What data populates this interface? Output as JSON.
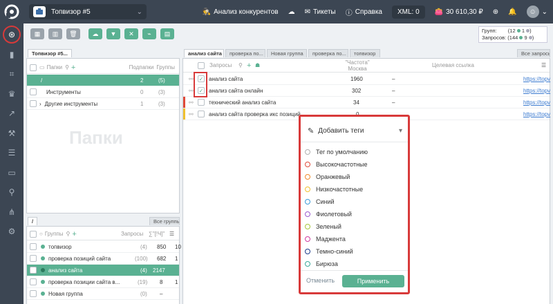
{
  "topbar": {
    "project_name": "Топвизор #5",
    "competitors": "Анализ конкурентов",
    "tickets": "Тикеты",
    "help": "Справка",
    "xml": "XML: 0",
    "balance": "30 610,30 ₽"
  },
  "stats": {
    "groups_label": "Групп:",
    "groups_total": "(12",
    "groups_on": "1",
    "groups_off": ")",
    "queries_label": "Запросов:",
    "queries_total": "(144",
    "queries_on": "9",
    "queries_off": ")"
  },
  "folders": {
    "tab": "Топвизор #5...",
    "header_folders": "Папки",
    "header_subfolders": "Подпапки",
    "header_groups": "Группы",
    "watermark": "Папки",
    "rows": [
      {
        "name": "/",
        "sub": "2",
        "groups": "(5)"
      },
      {
        "name": "Инструменты",
        "sub": "0",
        "groups": "(3)"
      },
      {
        "name": "Другие инструменты",
        "sub": "1",
        "groups": "(3)"
      }
    ]
  },
  "groups": {
    "tab": "/",
    "all_tab": "Все группы",
    "header_groups": "Группы",
    "header_queries": "Запросы",
    "header_freq": "∑\"[!Ч]\"",
    "rows": [
      {
        "name": "топвизор",
        "count": "(4)",
        "freq": "850",
        "extra": "10"
      },
      {
        "name": "проверка позиций сайта",
        "count": "(100)",
        "freq": "682",
        "extra": "1"
      },
      {
        "name": "анализ сайта",
        "count": "(4)",
        "freq": "2147",
        "extra": ""
      },
      {
        "name": "проверка позиции сайта в...",
        "count": "(19)",
        "freq": "8",
        "extra": "1"
      },
      {
        "name": "Новая группа",
        "count": "(0)",
        "freq": "–",
        "extra": ""
      }
    ]
  },
  "queries": {
    "tabs": [
      "анализ сайта",
      "проверка по...",
      "Новая группа",
      "проверка по...",
      "топвизор"
    ],
    "all_tab": "Все запросы",
    "header_queries": "Запросы",
    "header_freq": "\"Частота\"",
    "header_region": "Москва",
    "header_url": "Целевая ссылка",
    "rows": [
      {
        "text": "анализ сайта",
        "freq": "1960",
        "url": "–",
        "link": "https://topv"
      },
      {
        "text": "анализ сайта онлайн",
        "freq": "302",
        "url": "–",
        "link": "https://topv"
      },
      {
        "text": "технический анализ сайта",
        "freq": "34",
        "url": "–",
        "link": "https://topv"
      },
      {
        "text": "анализ сайта проверка икс позиций",
        "freq": "0",
        "url": "",
        "link": "https://topv"
      }
    ]
  },
  "popup": {
    "title": "Добавить теги",
    "tags": [
      {
        "label": "Тег по умолчанию",
        "color": "#b0b0b0"
      },
      {
        "label": "Высокочастотные",
        "color": "#e04a3a"
      },
      {
        "label": "Оранжевый",
        "color": "#f08a2a"
      },
      {
        "label": "Низкочастотные",
        "color": "#f0c030"
      },
      {
        "label": "Синий",
        "color": "#3a9ad9"
      },
      {
        "label": "Фиолетовый",
        "color": "#9a5ad0"
      },
      {
        "label": "Зеленый",
        "color": "#a6c63a"
      },
      {
        "label": "Маджента",
        "color": "#d03aa0"
      },
      {
        "label": "Темно-синий",
        "color": "#1a3a8a"
      },
      {
        "label": "Бирюза",
        "color": "#3aaa9a"
      }
    ],
    "cancel": "Отменить",
    "apply": "Применить"
  }
}
